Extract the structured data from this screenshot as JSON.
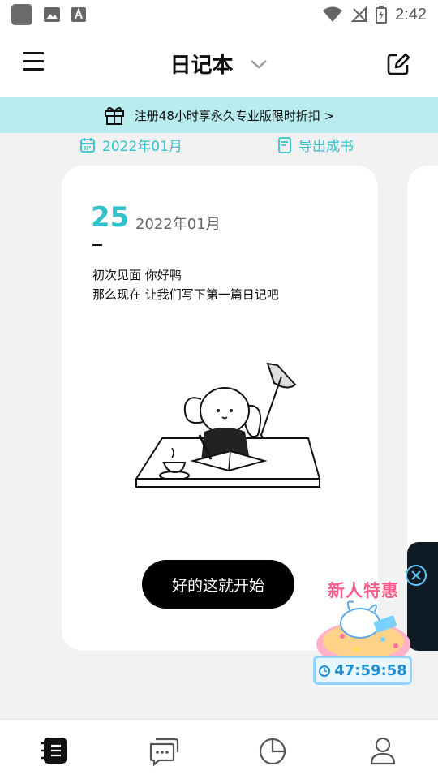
{
  "status_bar": {
    "time": "2:42",
    "icons": [
      "app-icon",
      "image-icon",
      "font-icon",
      "wifi-icon",
      "no-signal-icon",
      "battery-charging-icon"
    ]
  },
  "header": {
    "title": "日记本",
    "icons": {
      "menu": "menu-icon",
      "dropdown": "chevron-down-icon",
      "edit": "edit-icon"
    }
  },
  "promo_banner": {
    "text": "注册48小时享永久专业版限时折扣 >",
    "icon": "gift-icon",
    "background": "#b8ecee"
  },
  "toolbar": {
    "date_label": "2022年01月",
    "export_label": "导出成书",
    "accent": "#35c1c9"
  },
  "card": {
    "day": "25",
    "month": "2022年01月",
    "line1": "初次见面  你好鸭",
    "line2": "那么现在  让我们写下第一篇日记吧",
    "button_label": "好的这就开始",
    "illustration": "bunny-writing-at-desk"
  },
  "float_promo": {
    "title": "新人特惠",
    "countdown": "47:59:58",
    "close_icon": "close-circle-icon"
  },
  "bottom_nav": {
    "items": [
      {
        "name": "diary",
        "icon": "notebook-icon",
        "active": true
      },
      {
        "name": "messages",
        "icon": "chat-icon",
        "active": false
      },
      {
        "name": "stats",
        "icon": "pie-chart-icon",
        "active": false
      },
      {
        "name": "profile",
        "icon": "user-icon",
        "active": false
      }
    ]
  }
}
